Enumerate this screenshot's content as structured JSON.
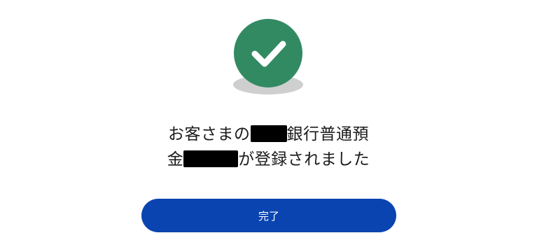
{
  "confirmation": {
    "message_line1_prefix": "お客さまの",
    "message_line1_suffix": "銀行普通預",
    "message_line2_prefix": "金",
    "message_line2_suffix": "が登録されました",
    "status_icon": "check-circle-icon",
    "status_color": "#328a62"
  },
  "actions": {
    "done_label": "完了",
    "button_color": "#0a44b0"
  }
}
